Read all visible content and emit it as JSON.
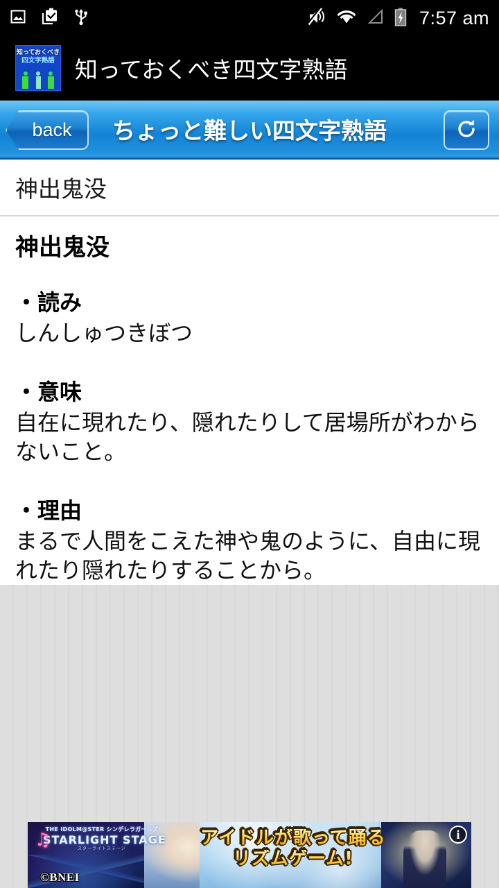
{
  "statusbar": {
    "time": "7:57 am",
    "left_icons": [
      "picture-icon",
      "clipboard-check-icon",
      "usb-icon"
    ],
    "right_icons": [
      "volume-mute-icon",
      "wifi-icon",
      "cellular-signal-icon",
      "battery-charging-icon"
    ]
  },
  "appbar": {
    "title": "知っておくべき四文字熟語",
    "icon": {
      "line1": "知っておくべき",
      "line2": "四文字熟語"
    }
  },
  "navbar": {
    "back_label": "back",
    "title": "ちょっと難しい四文字熟語",
    "refresh_icon": "refresh-icon"
  },
  "content": {
    "entry_word": "神出鬼没",
    "detail_title": "神出鬼没",
    "sections": [
      {
        "heading": "・読み",
        "body": "しんしゅつきぼつ"
      },
      {
        "heading": "・意味",
        "body": "自在に現れたり、隠れたりして居場所がわからないこと。"
      },
      {
        "heading": "・理由",
        "body": "まるで人間をこえた神や鬼のように、自由に現れたり隠れたりすることから。"
      }
    ]
  },
  "ad": {
    "logo_line1": "THE IDOLM@STER シンデレラガールズ",
    "logo_line2": "STARLIGHT STAGE",
    "logo_line3": "スターライトステージ",
    "headline_line1": "アイドルが歌って踊る",
    "headline_line2": "リズムゲーム!",
    "copyright": "©BNEI",
    "info_label": "i"
  },
  "colors": {
    "statusbar_bg": "#000000",
    "appbar_bg": "#000000",
    "navbar_blue": "#1383d6",
    "navbar_light": "#74c6f2",
    "content_bg": "#ffffff",
    "filler_gray": "#dedede",
    "text_black": "#111111",
    "app_icon_blue": "#1246c8"
  }
}
